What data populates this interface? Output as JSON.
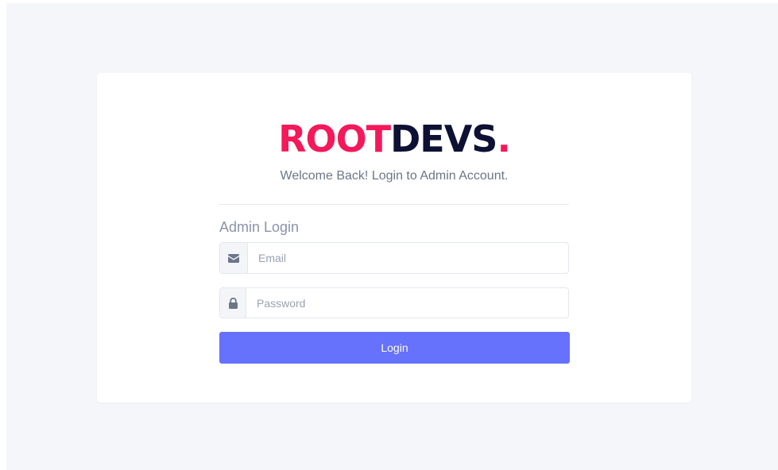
{
  "brand": {
    "part1": "ROOT",
    "part2": "DEVS",
    "part3": ".",
    "accent_color": "#f3195a",
    "dark_color": "#0e1134"
  },
  "tagline": "Welcome Back! Login to Admin Account.",
  "form": {
    "title": "Admin Login",
    "email": {
      "icon": "envelope-icon",
      "placeholder": "Email",
      "value": ""
    },
    "password": {
      "icon": "lock-icon",
      "placeholder": "Password",
      "value": ""
    },
    "submit_label": "Login",
    "submit_color": "#6672fb"
  }
}
